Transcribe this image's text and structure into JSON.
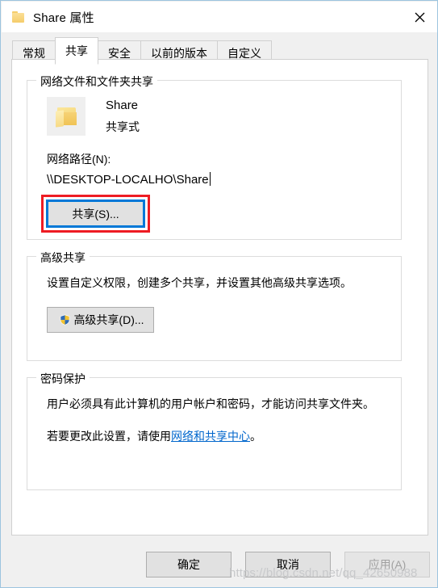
{
  "window": {
    "title": "Share 属性",
    "title_icon": "folder-icon",
    "close_icon": "close-icon",
    "border_color": "#9cc4df"
  },
  "tabs": [
    {
      "label": "常规",
      "active": false
    },
    {
      "label": "共享",
      "active": true
    },
    {
      "label": "安全",
      "active": false
    },
    {
      "label": "以前的版本",
      "active": false
    },
    {
      "label": "自定义",
      "active": false
    }
  ],
  "network_group": {
    "title": "网络文件和文件夹共享",
    "folder_icon": "open-folder-icon",
    "share_name": "Share",
    "share_state": "共享式",
    "path_label": "网络路径(N):",
    "path_value": "\\\\DESKTOP-LOCALHO\\Share",
    "share_button": "共享(S)...",
    "annotation_color": "#ee1c23",
    "focus_color": "#0078d7"
  },
  "advanced_group": {
    "title": "高级共享",
    "description": "设置自定义权限，创建多个共享，并设置其他高级共享选项。",
    "button_label": "高级共享(D)...",
    "button_icon": "uac-shield-icon"
  },
  "password_group": {
    "title": "密码保护",
    "line1": "用户必须具有此计算机的用户帐户和密码，才能访问共享文件夹。",
    "line2_before": "若要更改此设置，请使用",
    "line2_link": "网络和共享中心",
    "line2_after": "。",
    "link_color": "#0066cc"
  },
  "footer": {
    "ok": "确定",
    "cancel": "取消",
    "apply": "应用(A)",
    "apply_disabled": true
  },
  "watermark": {
    "text": "https://blog.csdn.net/qq_42650988"
  }
}
